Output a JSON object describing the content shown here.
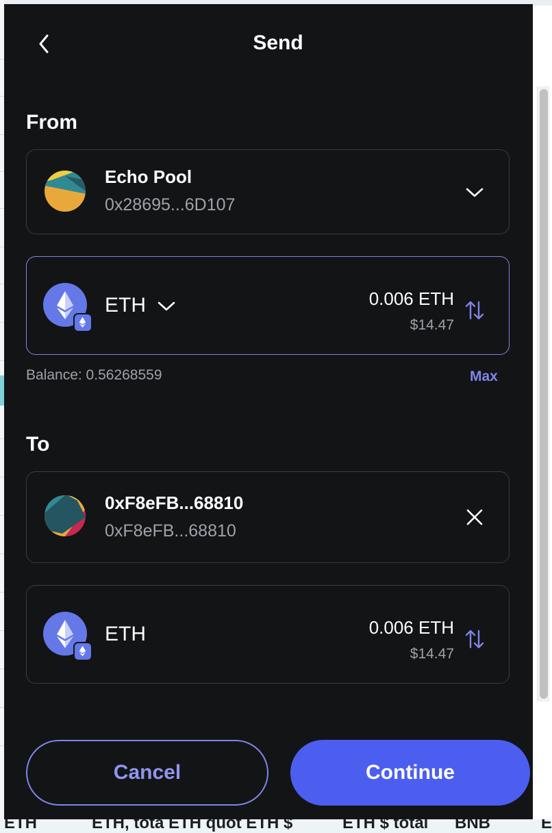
{
  "header": {
    "title": "Send"
  },
  "from": {
    "label": "From",
    "account": {
      "name": "Echo Pool",
      "address": "0x28695...6D107"
    },
    "token": {
      "symbol": "ETH",
      "amount": "0.006 ETH",
      "fiat": "$14.47"
    },
    "balance": "Balance: 0.56268559",
    "max_label": "Max"
  },
  "to": {
    "label": "To",
    "account": {
      "name": "0xF8eFB...68810",
      "address": "0xF8eFB...68810"
    },
    "token": {
      "symbol": "ETH",
      "amount": "0.006 ETH",
      "fiat": "$14.47"
    }
  },
  "actions": {
    "cancel_label": "Cancel",
    "continue_label": "Continue"
  },
  "background_text": [
    "ETH",
    "ETH, tota ETH quot ETH $",
    "ETH $ total",
    "BNB",
    "E"
  ],
  "colors": {
    "accent": "#7e85e8",
    "primary_button": "#4c5ef0",
    "panel": "#131416",
    "eth": "#6478e8"
  }
}
